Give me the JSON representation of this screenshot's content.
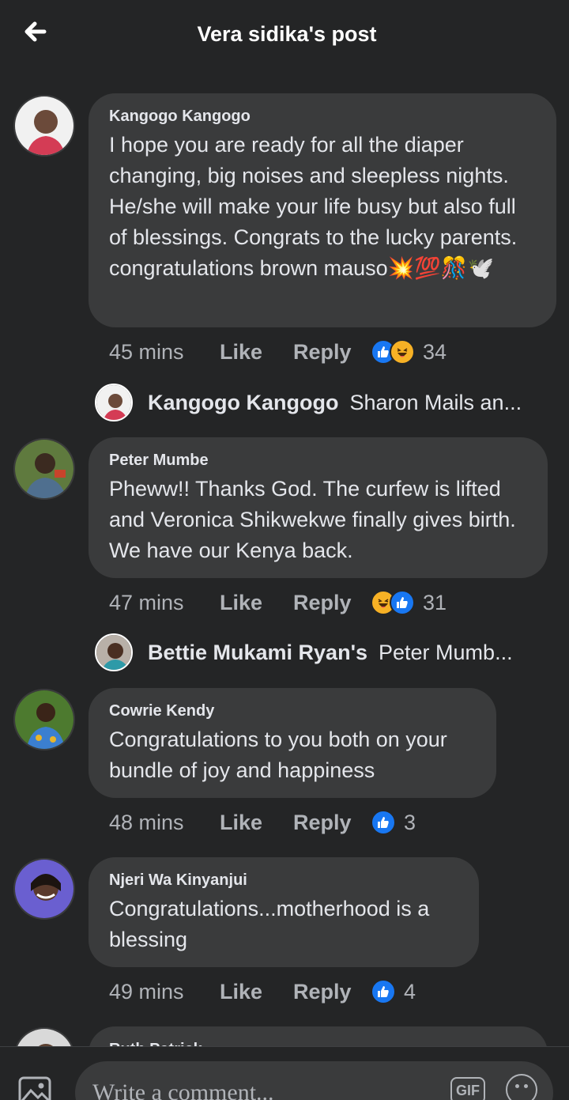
{
  "header": {
    "title": "Vera sidika's post"
  },
  "comments": [
    {
      "author": "Kangogo Kangogo",
      "text": "I hope you are ready for all the diaper changing, big noises and sleepless nights. He/she will make your life busy but also full of blessings. Congrats to the lucky parents. congratulations brown mauso💥💯🎊🕊️",
      "time": "45 mins",
      "like_label": "Like",
      "reply_label": "Reply",
      "reactions": [
        "like",
        "haha"
      ],
      "reaction_count": "34",
      "reply_preview": {
        "name": "Kangogo Kangogo",
        "snippet": "Sharon Mails an..."
      }
    },
    {
      "author": "Peter Mumbe",
      "text": "Pheww!! Thanks God. The curfew is lifted and Veronica Shikwekwe finally gives birth. We have our Kenya back.",
      "time": "47 mins",
      "like_label": "Like",
      "reply_label": "Reply",
      "reactions": [
        "haha",
        "like"
      ],
      "reaction_count": "31",
      "reply_preview": {
        "name": "Bettie Mukami Ryan's",
        "snippet": "Peter Mumb..."
      }
    },
    {
      "author": "Cowrie Kendy",
      "text": "Congratulations to you both on your bundle of joy and happiness",
      "time": "48 mins",
      "like_label": "Like",
      "reply_label": "Reply",
      "reactions": [
        "like"
      ],
      "reaction_count": "3"
    },
    {
      "author": "Njeri Wa Kinyanjui",
      "text": "Congratulations...motherhood is a blessing",
      "time": "49 mins",
      "like_label": "Like",
      "reply_label": "Reply",
      "reactions": [
        "like"
      ],
      "reaction_count": "4"
    },
    {
      "author": "Ruth Patrick"
    }
  ],
  "composer": {
    "placeholder": "Write a comment...",
    "gif_label": "GIF"
  },
  "colors": {
    "background": "#242526",
    "bubble": "#3a3b3c",
    "text": "#e4e6eb",
    "secondary_text": "#b0b3b8",
    "like_blue": "#1877f2",
    "haha_yellow": "#f7b125"
  }
}
